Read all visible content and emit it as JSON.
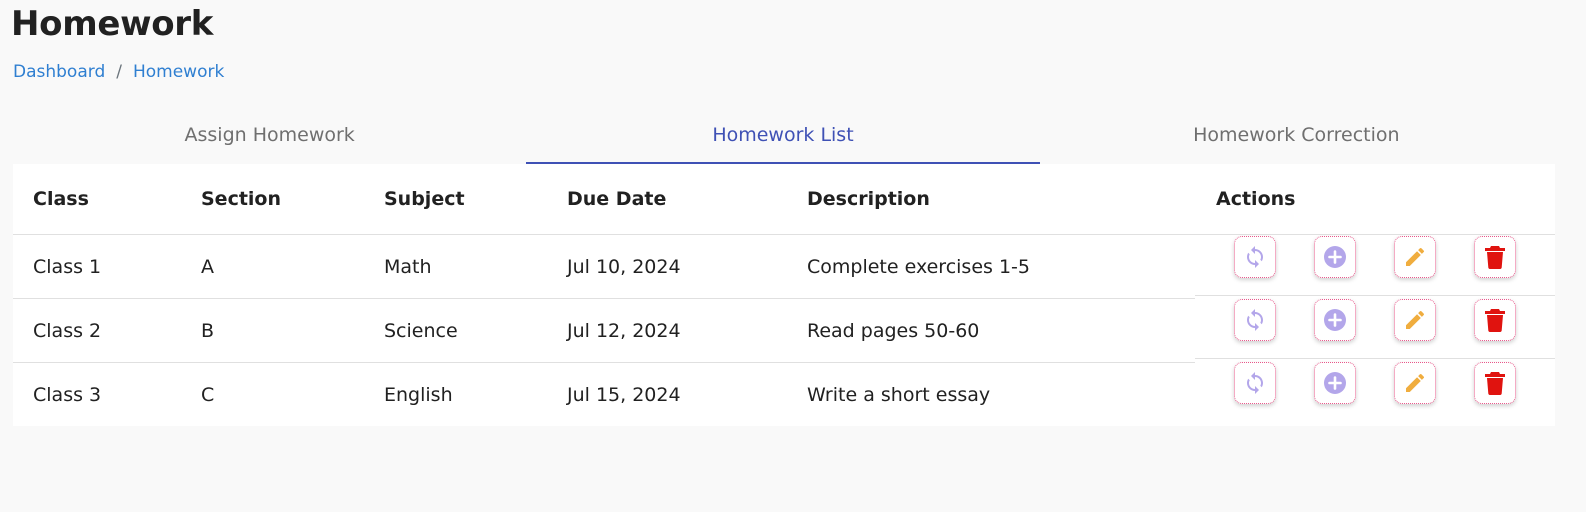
{
  "page": {
    "title": "Homework"
  },
  "breadcrumb": {
    "items": [
      "Dashboard",
      "Homework"
    ],
    "separator": "/"
  },
  "tabs": [
    {
      "label": "Assign Homework",
      "active": false
    },
    {
      "label": "Homework List",
      "active": true
    },
    {
      "label": "Homework Correction",
      "active": false
    }
  ],
  "table": {
    "headers": [
      "Class",
      "Section",
      "Subject",
      "Due Date",
      "Description",
      "Actions"
    ],
    "rows": [
      {
        "class": "Class 1",
        "section": "A",
        "subject": "Math",
        "due_date": "Jul 10, 2024",
        "description": "Complete exercises 1-5"
      },
      {
        "class": "Class 2",
        "section": "B",
        "subject": "Science",
        "due_date": "Jul 12, 2024",
        "description": "Read pages 50-60"
      },
      {
        "class": "Class 3",
        "section": "C",
        "subject": "English",
        "due_date": "Jul 15, 2024",
        "description": "Write a short essay"
      }
    ],
    "actions": [
      {
        "icon": "refresh-icon",
        "color": "#b3a6ea"
      },
      {
        "icon": "add-circle-icon",
        "color": "#b3a6ea"
      },
      {
        "icon": "pencil-icon",
        "color": "#f0ad3e"
      },
      {
        "icon": "trash-icon",
        "color": "#e0130f"
      }
    ]
  },
  "colors": {
    "link": "#2f7fd1",
    "active_tab": "#3f51b5",
    "inactive_tab": "#6f6f6f",
    "action_border": "#e8578a",
    "background": "#f9f9f9"
  }
}
